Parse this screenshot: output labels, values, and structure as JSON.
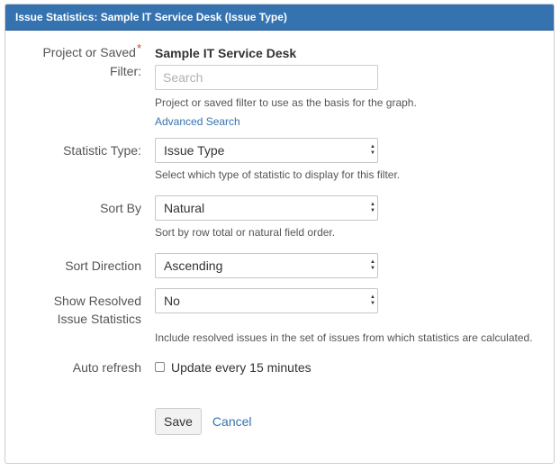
{
  "header": {
    "title": "Issue Statistics: Sample IT Service Desk (Issue Type)"
  },
  "project": {
    "label_line1": "Project or Saved",
    "label_line2": "Filter:",
    "required_mark": "*",
    "selected_name": "Sample IT Service Desk",
    "search_placeholder": "Search",
    "description": "Project or saved filter to use as the basis for the graph.",
    "advanced_link": "Advanced Search"
  },
  "statistic_type": {
    "label": "Statistic Type:",
    "value": "Issue Type",
    "description": "Select which type of statistic to display for this filter."
  },
  "sort_by": {
    "label": "Sort By",
    "value": "Natural",
    "description": "Sort by row total or natural field order."
  },
  "sort_direction": {
    "label": "Sort Direction",
    "value": "Ascending"
  },
  "show_resolved": {
    "label_line1": "Show Resolved",
    "label_line2": "Issue Statistics",
    "value": "No",
    "description": "Include resolved issues in the set of issues from which statistics are calculated."
  },
  "auto_refresh": {
    "label": "Auto refresh",
    "checkbox_label": "Update every 15 minutes",
    "checked": false
  },
  "actions": {
    "save_label": "Save",
    "cancel_label": "Cancel"
  }
}
